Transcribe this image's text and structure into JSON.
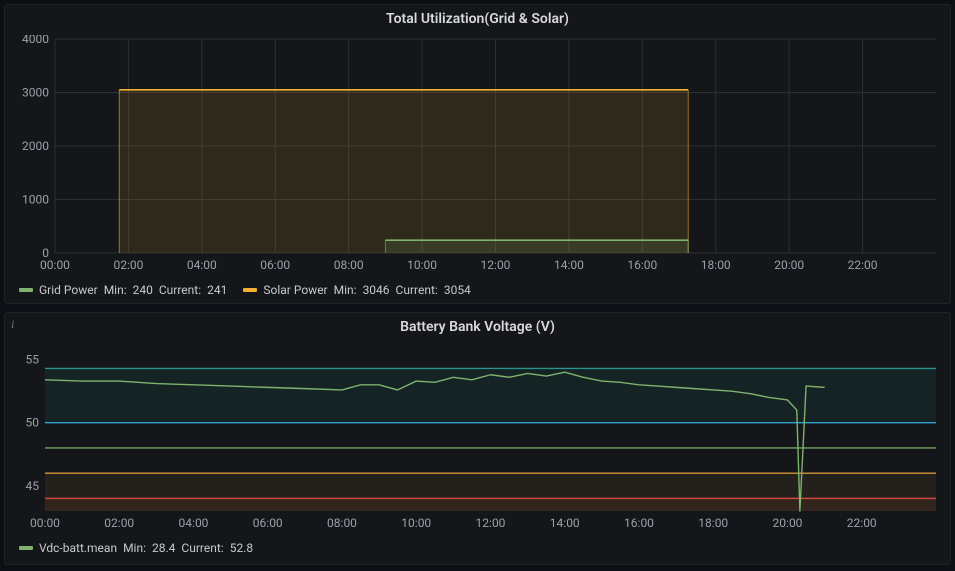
{
  "panel1": {
    "title": "Total Utilization(Grid & Solar)",
    "legend": {
      "series1_name": "Grid Power",
      "series1_min_label": "Min:",
      "series1_min": "240",
      "series1_cur_label": "Current:",
      "series1_cur": "241",
      "series2_name": "Solar Power",
      "series2_min_label": "Min:",
      "series2_min": "3046",
      "series2_cur_label": "Current:",
      "series2_cur": "3054"
    }
  },
  "panel2": {
    "title": "Battery Bank Voltage (V)",
    "legend": {
      "series1_name": "Vdc-batt.mean",
      "series1_min_label": "Min:",
      "series1_min": "28.4",
      "series1_cur_label": "Current:",
      "series1_cur": "52.8"
    }
  },
  "chart_data": [
    {
      "type": "area",
      "title": "Total Utilization(Grid & Solar)",
      "xlabel": "",
      "ylabel": "",
      "ylim": [
        0,
        4000
      ],
      "x_ticks": [
        "00:00",
        "02:00",
        "04:00",
        "06:00",
        "08:00",
        "10:00",
        "12:00",
        "14:00",
        "16:00",
        "18:00",
        "20:00",
        "22:00"
      ],
      "y_ticks": [
        0,
        1000,
        2000,
        3000,
        4000
      ],
      "series": [
        {
          "name": "Solar Power",
          "color": "#f2b134",
          "x": [
            "01:45",
            "17:15"
          ],
          "values": [
            3050,
            3050
          ],
          "min": 3046,
          "current": 3054
        },
        {
          "name": "Grid Power",
          "color": "#7eb26d",
          "x": [
            "09:00",
            "17:15"
          ],
          "values": [
            240,
            241
          ],
          "min": 240,
          "current": 241
        }
      ]
    },
    {
      "type": "line",
      "title": "Battery Bank Voltage (V)",
      "xlabel": "",
      "ylabel": "",
      "ylim": [
        43,
        56
      ],
      "x_ticks": [
        "00:00",
        "02:00",
        "04:00",
        "06:00",
        "08:00",
        "10:00",
        "12:00",
        "14:00",
        "16:00",
        "18:00",
        "20:00",
        "22:00"
      ],
      "y_ticks": [
        45,
        50,
        55
      ],
      "thresholds": [
        {
          "value": 54.3,
          "color": "#2aa198"
        },
        {
          "value": 50.0,
          "color": "#33b5e5"
        },
        {
          "value": 48.0,
          "color": "#7eb26d"
        },
        {
          "value": 46.0,
          "color": "#e5a23c"
        },
        {
          "value": 44.0,
          "color": "#e24d42"
        }
      ],
      "series": [
        {
          "name": "Vdc-batt.mean",
          "color": "#7eb26d",
          "x": [
            "00:00",
            "01:00",
            "02:00",
            "03:00",
            "04:00",
            "05:00",
            "06:00",
            "07:00",
            "08:00",
            "08:30",
            "09:00",
            "09:30",
            "10:00",
            "10:30",
            "11:00",
            "11:30",
            "12:00",
            "12:30",
            "13:00",
            "13:30",
            "14:00",
            "14:30",
            "15:00",
            "15:30",
            "16:00",
            "16:30",
            "17:00",
            "17:30",
            "18:00",
            "18:30",
            "19:00",
            "19:30",
            "20:00",
            "20:15",
            "20:20",
            "20:30",
            "21:00"
          ],
          "values": [
            53.4,
            53.3,
            53.3,
            53.1,
            53.0,
            52.9,
            52.8,
            52.7,
            52.6,
            53.0,
            53.0,
            52.6,
            53.3,
            53.2,
            53.6,
            53.4,
            53.8,
            53.6,
            53.9,
            53.7,
            54.0,
            53.6,
            53.3,
            53.2,
            53.0,
            52.9,
            52.8,
            52.7,
            52.6,
            52.5,
            52.3,
            52.0,
            51.8,
            51.0,
            28.4,
            52.9,
            52.8
          ],
          "min": 28.4,
          "current": 52.8
        }
      ]
    }
  ]
}
